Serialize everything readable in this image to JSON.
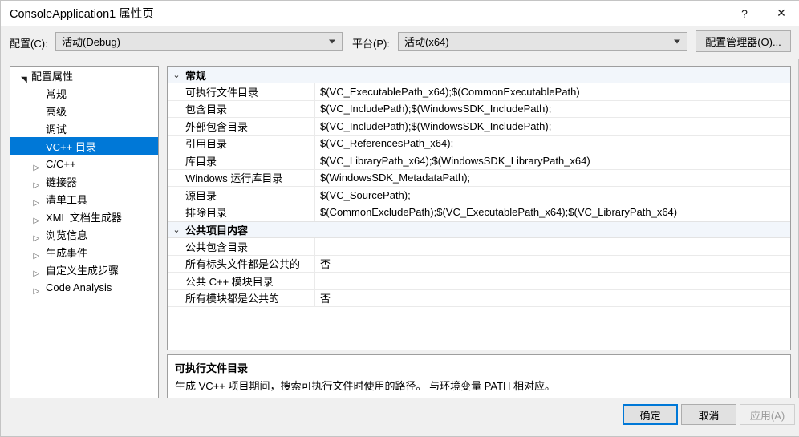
{
  "window": {
    "title": "ConsoleApplication1 属性页",
    "help_icon": "?",
    "close_icon": "✕"
  },
  "toolbar": {
    "configuration_label": "配置(C):",
    "configuration_value": "活动(Debug)",
    "platform_label": "平台(P):",
    "platform_value": "活动(x64)",
    "config_manager_label": "配置管理器(O)..."
  },
  "tree": {
    "items": [
      {
        "label": "配置属性",
        "indent": 0,
        "expander": "expanded",
        "selected": false
      },
      {
        "label": "常规",
        "indent": 1,
        "expander": "none",
        "selected": false
      },
      {
        "label": "高级",
        "indent": 1,
        "expander": "none",
        "selected": false
      },
      {
        "label": "调试",
        "indent": 1,
        "expander": "none",
        "selected": false
      },
      {
        "label": "VC++ 目录",
        "indent": 1,
        "expander": "none",
        "selected": true
      },
      {
        "label": "C/C++",
        "indent": 1,
        "expander": "collapsed",
        "selected": false
      },
      {
        "label": "链接器",
        "indent": 1,
        "expander": "collapsed",
        "selected": false
      },
      {
        "label": "清单工具",
        "indent": 1,
        "expander": "collapsed",
        "selected": false
      },
      {
        "label": "XML 文档生成器",
        "indent": 1,
        "expander": "collapsed",
        "selected": false
      },
      {
        "label": "浏览信息",
        "indent": 1,
        "expander": "collapsed",
        "selected": false
      },
      {
        "label": "生成事件",
        "indent": 1,
        "expander": "collapsed",
        "selected": false
      },
      {
        "label": "自定义生成步骤",
        "indent": 1,
        "expander": "collapsed",
        "selected": false
      },
      {
        "label": "Code Analysis",
        "indent": 1,
        "expander": "collapsed",
        "selected": false
      }
    ]
  },
  "grid": {
    "groups": [
      {
        "title": "常规",
        "chevron": "⌄",
        "rows": [
          {
            "name": "可执行文件目录",
            "value": "$(VC_ExecutablePath_x64);$(CommonExecutablePath)"
          },
          {
            "name": "包含目录",
            "value": "$(VC_IncludePath);$(WindowsSDK_IncludePath);"
          },
          {
            "name": "外部包含目录",
            "value": "$(VC_IncludePath);$(WindowsSDK_IncludePath);"
          },
          {
            "name": "引用目录",
            "value": "$(VC_ReferencesPath_x64);"
          },
          {
            "name": "库目录",
            "value": "$(VC_LibraryPath_x64);$(WindowsSDK_LibraryPath_x64)"
          },
          {
            "name": "Windows 运行库目录",
            "value": "$(WindowsSDK_MetadataPath);"
          },
          {
            "name": "源目录",
            "value": "$(VC_SourcePath);"
          },
          {
            "name": "排除目录",
            "value": "$(CommonExcludePath);$(VC_ExecutablePath_x64);$(VC_LibraryPath_x64)"
          }
        ]
      },
      {
        "title": "公共项目内容",
        "chevron": "⌄",
        "rows": [
          {
            "name": "公共包含目录",
            "value": ""
          },
          {
            "name": "所有标头文件都是公共的",
            "value": "否"
          },
          {
            "name": "公共 C++ 模块目录",
            "value": ""
          },
          {
            "name": "所有模块都是公共的",
            "value": "否"
          }
        ]
      }
    ]
  },
  "description": {
    "title": "可执行文件目录",
    "body": "生成 VC++ 项目期间，搜索可执行文件时使用的路径。 与环境变量 PATH 相对应。"
  },
  "footer": {
    "ok_label": "确定",
    "cancel_label": "取消",
    "apply_label": "应用(A)"
  },
  "colors": {
    "accent": "#0078d7",
    "dialog_bg": "#f0f0f0",
    "panel_bg": "#ffffff",
    "group_header_bg": "#f2f6fb"
  }
}
